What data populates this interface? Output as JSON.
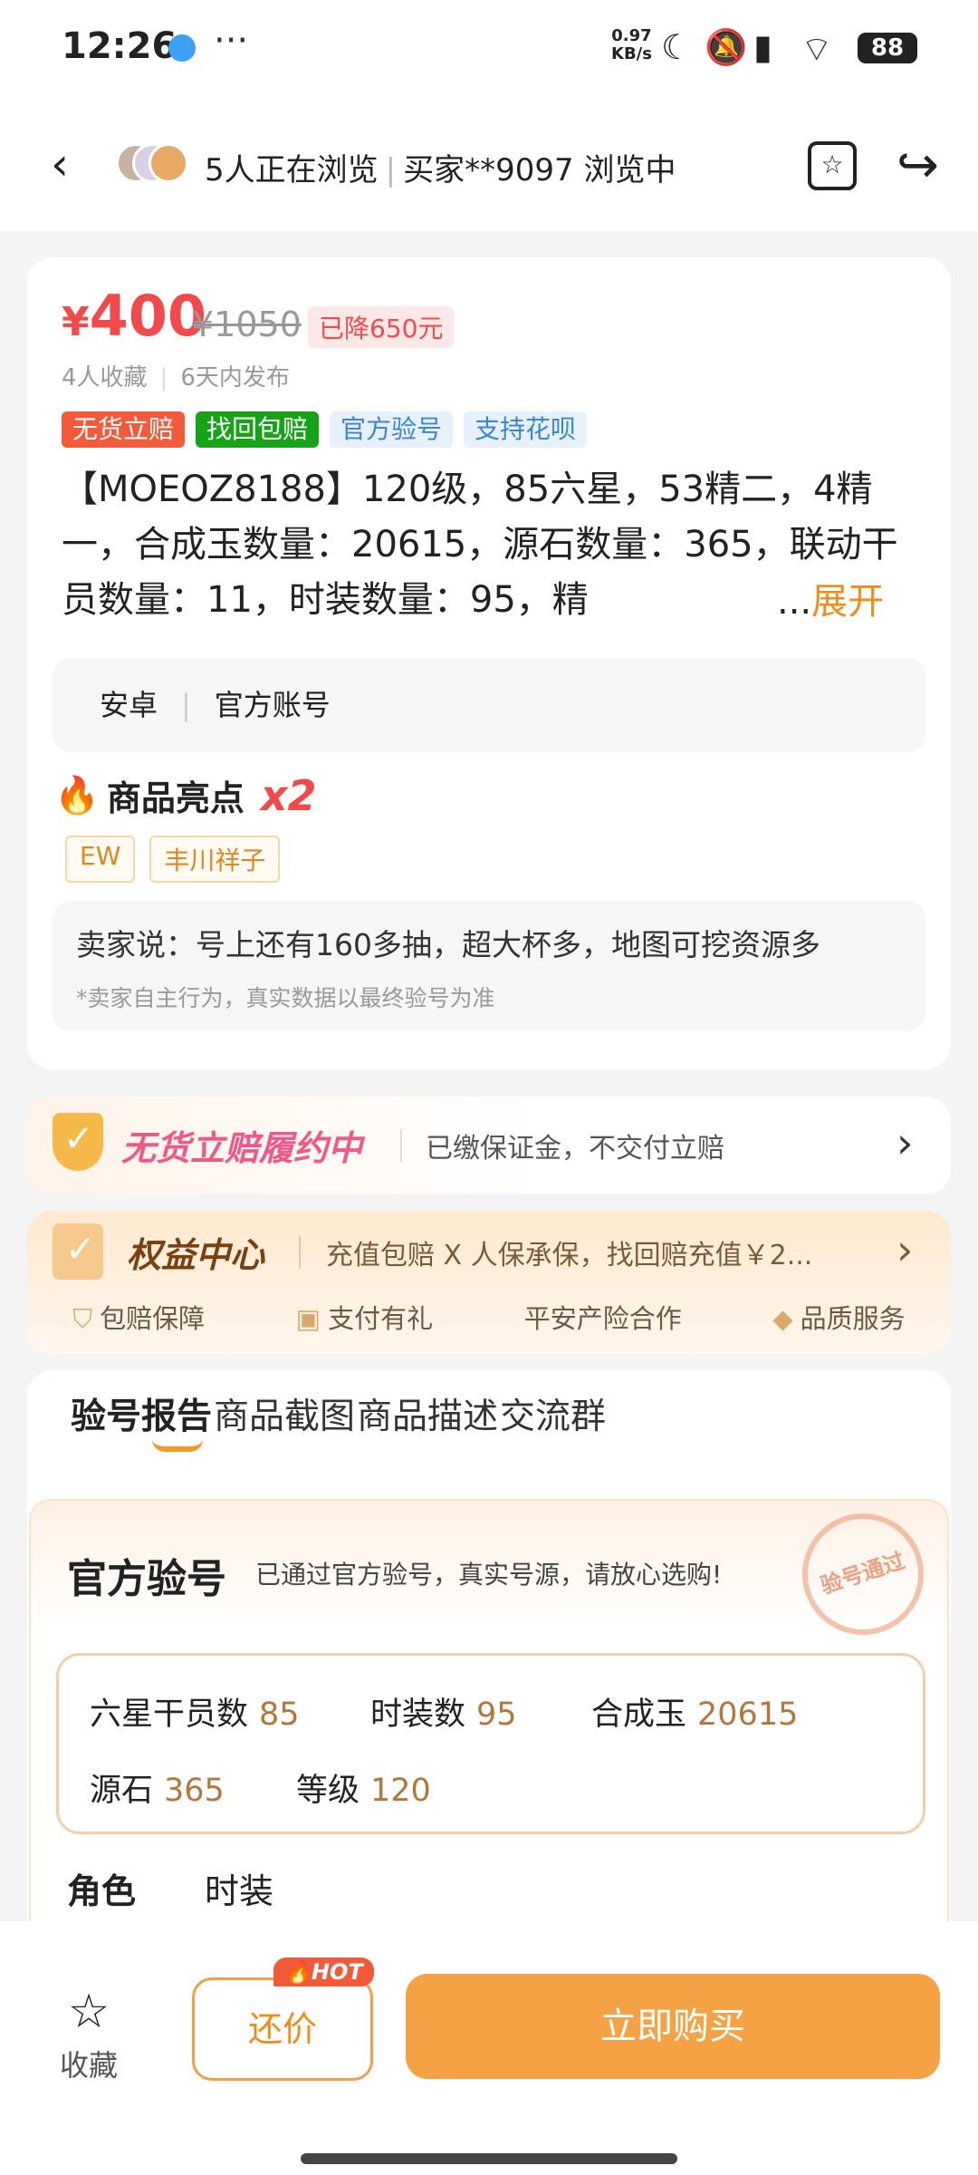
{
  "status": {
    "time": "12:26",
    "more": "···",
    "speed_value": "0.97",
    "speed_unit": "KB/s",
    "battery": "88"
  },
  "nav": {
    "back": "‹",
    "title_left": "5人正在浏览",
    "title_right": "买家**9097 浏览中",
    "share": "↪"
  },
  "product": {
    "currency": "¥",
    "price": "400",
    "old_price": "¥1050",
    "drop": "已降650元",
    "favorites": "4人收藏",
    "published": "6天内发布",
    "tags": [
      {
        "label": "无货立赔",
        "bg": "#f25a3a",
        "color": "#ffffff"
      },
      {
        "label": "找回包赔",
        "bg": "#17a317",
        "color": "#ffffff"
      },
      {
        "label": "官方验号",
        "bg": "#e7f1fd",
        "color": "#3b84d6"
      },
      {
        "label": "支持花呗",
        "bg": "#e7f1fd",
        "color": "#3b84d6"
      }
    ],
    "description": "【MOEOZ8188】120级，85六星，53精二，4精一，合成玉数量：20615，源石数量：365，联动干员数量：11，时装数量：95，精",
    "expand_ellipsis": "...",
    "expand_label": "展开",
    "platform": "安卓",
    "account_type": "官方账号",
    "highlights_title": "商品亮点",
    "highlights_count": "x2",
    "highlights": [
      "EW",
      "丰川祥子"
    ],
    "seller_says": "卖家说：号上还有160多抽，超大杯多，地图可挖资源多",
    "seller_note": "*卖家自主行为，真实数据以最终验号为准"
  },
  "guarantee": {
    "title": "无货立赔履约中",
    "subtitle": "已缴保证金，不交付立赔"
  },
  "rights": {
    "title": "权益中心",
    "subtitle": "充值包赔 X 人保承保，找回赔充值￥2...",
    "items": [
      "包赔保障",
      "支付有礼",
      "平安产险合作",
      "品质服务"
    ]
  },
  "tabs": [
    "验号报告",
    "商品截图",
    "商品描述",
    "交流群"
  ],
  "report": {
    "title": "官方验号",
    "subtitle": "已通过官方验号，真实号源，请放心选购!",
    "stamp": "验号通过",
    "stats": [
      {
        "label": "六星干员数",
        "value": "85"
      },
      {
        "label": "时装数",
        "value": "95"
      },
      {
        "label": "合成玉",
        "value": "20615"
      },
      {
        "label": "源石",
        "value": "365"
      },
      {
        "label": "等级",
        "value": "120"
      }
    ],
    "roles_label": "角色",
    "skins_label": "时装"
  },
  "bottom": {
    "collect": "收藏",
    "bargain": "还价",
    "hot": "HOT",
    "buy": "立即购买"
  }
}
